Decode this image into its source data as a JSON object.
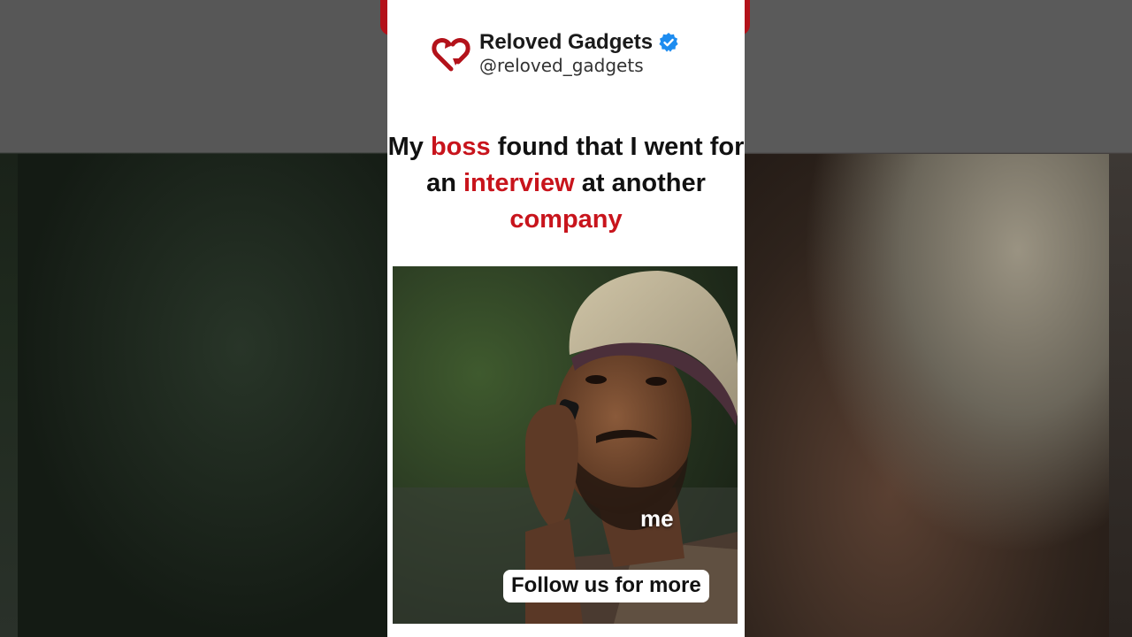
{
  "brand": {
    "name": "Reloved Gadgets",
    "handle": "@reloved_gadgets",
    "logo_icon": "recycle-heart-icon",
    "verified_icon": "verified-badge-icon",
    "accent_color": "#c8141c",
    "verified_color": "#1d8cf0"
  },
  "headline": {
    "part1": "My ",
    "word_boss": "boss",
    "part2": " found that I went for an ",
    "word_interview": "interview",
    "part3": " at another ",
    "word_company": "company"
  },
  "video": {
    "caption": "me",
    "cta": "Follow us for more"
  }
}
